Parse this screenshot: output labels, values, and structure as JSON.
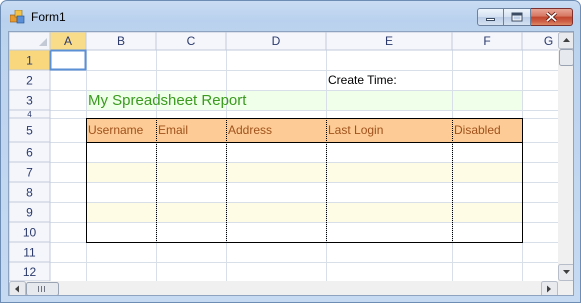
{
  "window": {
    "title": "Form1"
  },
  "spreadsheet": {
    "columns": [
      "A",
      "B",
      "C",
      "D",
      "E",
      "F",
      "G"
    ],
    "rows": [
      "1",
      "2",
      "3",
      "4",
      "5",
      "6",
      "7",
      "8",
      "9",
      "10",
      "11",
      "12"
    ],
    "create_time_label": "Create Time:",
    "report_title": "My Spreadsheet Report",
    "table_headers": [
      "Username",
      "Email",
      "Address",
      "Last Login",
      "Disabled"
    ],
    "selected_cell": "A1"
  },
  "colors": {
    "header_fill": "#fdcb95",
    "header_text": "#a0521c",
    "title_text": "#3a9b1f",
    "title_fill": "#f0ffe9",
    "band_fill": "#fffce6",
    "col_header_selected": "#f9dc8a",
    "row_header_selected": "#f8d77d"
  }
}
